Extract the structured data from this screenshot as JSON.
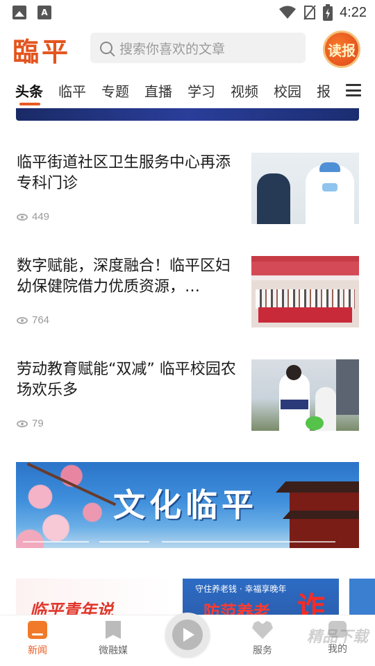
{
  "status_bar": {
    "time": "4:22"
  },
  "header": {
    "logo": "臨平",
    "search_placeholder": "搜索你喜欢的文章",
    "badge_label": "读报"
  },
  "tabs": [
    "头条",
    "临平",
    "专题",
    "直播",
    "学习",
    "视频",
    "校园",
    "报"
  ],
  "articles": [
    {
      "title": "临平街道社区卫生服务中心再添专科门诊",
      "views": "449"
    },
    {
      "title": "数字赋能，深度融合！临平区妇幼保健院借力优质资源，…",
      "views": "764"
    },
    {
      "title": "劳动教育赋能“双减” 临平校园农场欢乐多",
      "views": "79"
    }
  ],
  "culture_banner": {
    "label": "文化临平"
  },
  "promo": {
    "card1_text": "临平青年说",
    "card2_sub": "守住养老钱 · 幸福享晚年",
    "card2_big": "防范养老",
    "card2_big2": "诈"
  },
  "bottom_nav": {
    "items": [
      {
        "label": "新闻",
        "icon": "home-icon",
        "active": true
      },
      {
        "label": "微融媒",
        "icon": "bookmark-icon",
        "active": false
      },
      {
        "label": "服务",
        "icon": "heart-icon",
        "active": false
      },
      {
        "label": "我的",
        "icon": "chat-icon",
        "active": false
      }
    ]
  },
  "watermark": "精品下载",
  "colors": {
    "accent": "#e85b21",
    "logo": "#e3541e"
  }
}
